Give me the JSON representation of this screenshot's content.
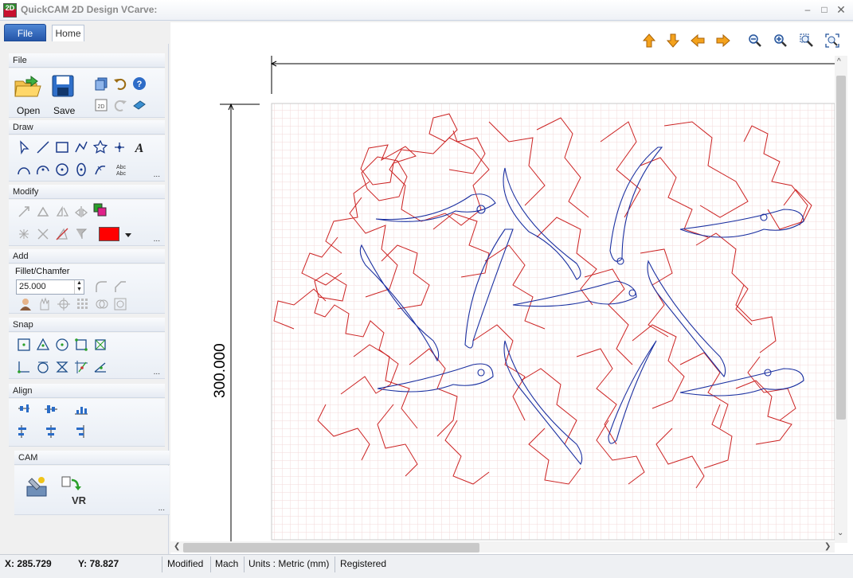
{
  "window": {
    "title": "QuickCAM 2D Design VCarve:"
  },
  "tabs": {
    "file": "File",
    "home": "Home"
  },
  "panels": {
    "file": {
      "title": "File",
      "open": "Open",
      "save": "Save"
    },
    "draw": {
      "title": "Draw"
    },
    "modify": {
      "title": "Modify",
      "color": "#ff0000"
    },
    "add": {
      "title": "Add",
      "fillet_label": "Fillet/Chamfer",
      "fillet_value": "25.000"
    },
    "snap": {
      "title": "Snap"
    },
    "align": {
      "title": "Align"
    },
    "cam": {
      "title": "CAM",
      "vr_label": "VR"
    }
  },
  "canvas": {
    "dimension_label": "300.000",
    "line_colors": {
      "outline": "#cc2222",
      "detail": "#1a2fa0"
    }
  },
  "status": {
    "x": "X: 285.729",
    "y": "Y: 78.827",
    "modified": "Modified",
    "mach": "Mach",
    "units": "Units : Metric (mm)",
    "registered": "Registered"
  },
  "more_glyph": "..."
}
